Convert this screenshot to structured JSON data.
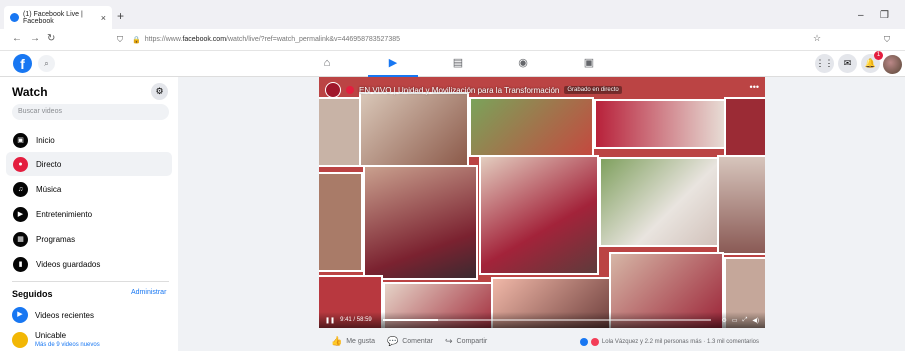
{
  "browser": {
    "tab_title": "(1) Facebook Live | Facebook",
    "tab_close": "×",
    "new_tab": "+",
    "url_prefix": "https://www.",
    "url_domain": "facebook.com",
    "url_path": "/watch/live/?ref=watch_permalink&v=446958783527385",
    "minimize": "–",
    "restore": "❐"
  },
  "fb": {
    "logo": "f",
    "nav_icons": [
      "home-icon",
      "watch-icon",
      "marketplace-icon",
      "groups-icon",
      "gaming-icon"
    ],
    "notification_count": "1"
  },
  "sidebar": {
    "title": "Watch",
    "search_placeholder": "Buscar videos",
    "items": [
      {
        "label": "Inicio",
        "icon": "home-icon"
      },
      {
        "label": "Directo",
        "icon": "live-icon"
      },
      {
        "label": "Música",
        "icon": "music-icon"
      },
      {
        "label": "Entretenimiento",
        "icon": "entertainment-icon"
      },
      {
        "label": "Programas",
        "icon": "shows-icon"
      },
      {
        "label": "Videos guardados",
        "icon": "bookmark-icon"
      }
    ],
    "section_title": "Seguidos",
    "admin_link": "Administrar",
    "followed": [
      {
        "name": "Videos recientes"
      },
      {
        "name": "Unicable",
        "sub": "Más de 9 videos nuevos"
      }
    ]
  },
  "video": {
    "title": "EN VIVO | Unidad y Movilización para la Transformación",
    "recorded_badge": "Grabado en directo",
    "time": "9:41 / 58:59",
    "progress": 0.17
  },
  "actions": {
    "like": "Me gusta",
    "comment": "Comentar",
    "share": "Compartir",
    "reactions_text": "Lola Vázquez y 2.2 mil personas más · 1.3 mil comentarios"
  },
  "colors": {
    "fb_blue": "#1877f2",
    "live_red": "#e41e3f",
    "morena_red": "#a0172b"
  }
}
